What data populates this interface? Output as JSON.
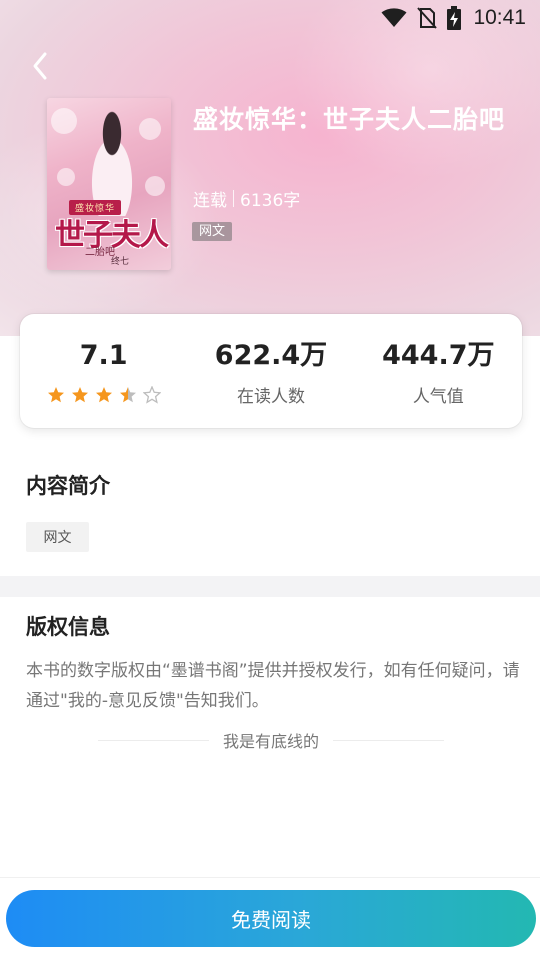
{
  "status_bar": {
    "time": "10:41"
  },
  "book": {
    "title": "盛妆惊华：世子夫人二胎吧",
    "status": "连载",
    "word_count": "6136字",
    "genre_tag": "网文",
    "cover": {
      "series_text": "盛妆惊华",
      "title_text": "世子夫人",
      "subtitle_text": "二胎吧",
      "author_text": "终七"
    }
  },
  "stats": {
    "rating": {
      "value": "7.1",
      "stars_filled": 3.5,
      "stars_total": 5
    },
    "readers": {
      "value": "622.4万",
      "label": "在读人数"
    },
    "popularity": {
      "value": "444.7万",
      "label": "人气值"
    }
  },
  "intro": {
    "title": "内容简介",
    "tag": "网文"
  },
  "copyright": {
    "title": "版权信息",
    "text": "本书的数字版权由“墨谱书阁”提供并授权发行，如有任何疑问，请通过\"我的-意见反馈\"告知我们。"
  },
  "end_marker": "我是有底线的",
  "actions": {
    "read_button": "免费阅读"
  },
  "colors": {
    "star_filled": "#f5961d",
    "star_empty": "#bdbdbd",
    "button_gradient_start": "#1e8cf5",
    "button_gradient_end": "#23b8b2"
  }
}
